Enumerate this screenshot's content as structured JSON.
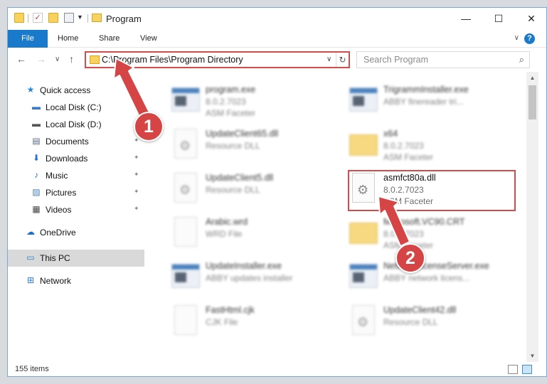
{
  "window": {
    "title": "Program",
    "controls": {
      "minimize": "—",
      "maximize": "☐",
      "close": "✕"
    }
  },
  "quick_access_toolbar": {
    "icons": [
      "folder-icon",
      "properties-check-icon",
      "new-folder-icon",
      "customize-icon"
    ]
  },
  "ribbon": {
    "tabs": [
      "File",
      "Home",
      "Share",
      "View"
    ],
    "expand_glyph": "∨",
    "help_glyph": "?"
  },
  "nav": {
    "back": "←",
    "forward": "→",
    "recent": "∨",
    "up": "↑",
    "address": "C:\\Program Files\\Program Directory",
    "address_drop": "∨",
    "refresh": "↻",
    "search_placeholder": "Search Program",
    "search_glyph": "⌕"
  },
  "sidebar": {
    "items": [
      {
        "label": "Quick access",
        "icon": "star-icon",
        "glyph": "★"
      },
      {
        "label": "Local Disk (C:)",
        "icon": "windows-drive-icon",
        "glyph": "▬"
      },
      {
        "label": "Local Disk (D:)",
        "icon": "drive-icon",
        "glyph": "▬"
      },
      {
        "label": "Documents",
        "icon": "documents-icon",
        "glyph": "▤"
      },
      {
        "label": "Downloads",
        "icon": "downloads-icon",
        "glyph": "⬇"
      },
      {
        "label": "Music",
        "icon": "music-icon",
        "glyph": "♪"
      },
      {
        "label": "Pictures",
        "icon": "pictures-icon",
        "glyph": "▨"
      },
      {
        "label": "Videos",
        "icon": "videos-icon",
        "glyph": "▦"
      },
      {
        "label": "OneDrive",
        "icon": "onedrive-icon",
        "glyph": "☁"
      },
      {
        "label": "This PC",
        "icon": "this-pc-icon",
        "glyph": "▭"
      },
      {
        "label": "Network",
        "icon": "network-icon",
        "glyph": "⊞"
      }
    ],
    "pin_glyph": "✦"
  },
  "files": [
    {
      "name": "program.exe",
      "line2": "8.0.2.7023",
      "line3": "ASM Faceter",
      "icon": "exe-icon"
    },
    {
      "name": "TrigrammInstaller.exe",
      "line2": "ABBY finereader tri...",
      "line3": "",
      "icon": "app-icon"
    },
    {
      "name": "UpdateClient65.dll",
      "line2": "Resource DLL",
      "line3": "",
      "icon": "dll-icon"
    },
    {
      "name": "x64",
      "line2": "8.0.2.7023",
      "line3": "ASM Faceter",
      "icon": "folder-icon"
    },
    {
      "name": "UpdateClient5.dll",
      "line2": "Resource DLL",
      "line3": "",
      "icon": "dll-icon"
    },
    {
      "name": "asmfct80a.dll",
      "line2": "8.0.2.7023",
      "line3": "ASM Faceter",
      "icon": "dll-icon"
    },
    {
      "name": "Arabic.wrd",
      "line2": "WRD File",
      "line3": "",
      "icon": "file-icon"
    },
    {
      "name": "Microsoft.VC90.CRT",
      "line2": "8.0.2.7023",
      "line3": "ASM Faceter",
      "icon": "folder-icon"
    },
    {
      "name": "UpdateInstaller.exe",
      "line2": "ABBY updates installer",
      "line3": "",
      "icon": "app-icon"
    },
    {
      "name": "NetworkLicenseServer.exe",
      "line2": "ABBY network licens...",
      "line3": "",
      "icon": "app-icon"
    },
    {
      "name": "FastHtml.cjk",
      "line2": "CJK File",
      "line3": "",
      "icon": "file-icon"
    },
    {
      "name": "UpdateClient42.dll",
      "line2": "Resource DLL",
      "line3": "",
      "icon": "dll-icon"
    }
  ],
  "status": {
    "items_count": "155 items"
  },
  "annotations": {
    "step1": "1",
    "step2": "2"
  },
  "colors": {
    "accent": "#1979ca",
    "highlight": "#d44b4b"
  }
}
